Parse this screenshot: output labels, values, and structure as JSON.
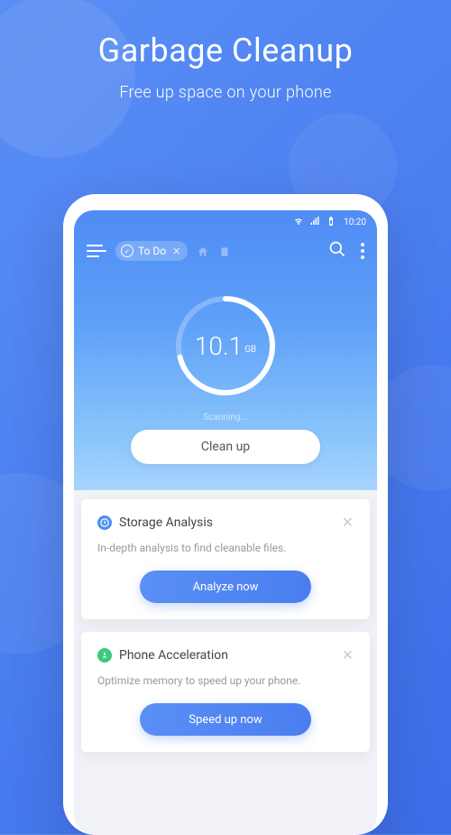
{
  "hero": {
    "title": "Garbage Cleanup",
    "subtitle": "Free up space on your phone"
  },
  "status": {
    "time": "10:20"
  },
  "nav": {
    "chip_label": "To Do"
  },
  "gauge": {
    "value": "10.1",
    "unit": "GB",
    "status": "Scanning...",
    "clean_button": "Clean up"
  },
  "cards": [
    {
      "title": "Storage Analysis",
      "description": "In-depth analysis to find cleanable files.",
      "button": "Analyze now"
    },
    {
      "title": "Phone Acceleration",
      "description": "Optimize memory to speed up your phone.",
      "button": "Speed up now"
    }
  ]
}
